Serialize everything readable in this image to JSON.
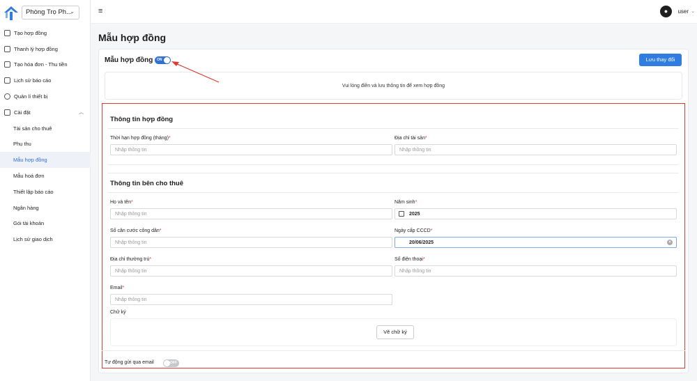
{
  "sidebar": {
    "property_select": "Phòng Trọ Ph...",
    "items": [
      {
        "label": "Tạo hợp đồng"
      },
      {
        "label": "Thanh lý hợp đồng"
      },
      {
        "label": "Tạo hóa đơn - Thu tiền"
      },
      {
        "label": "Lịch sử báo cáo"
      },
      {
        "label": "Quản lí thiết bị"
      },
      {
        "label": "Cài đặt"
      }
    ],
    "sub_items": [
      {
        "label": "Tài sản cho thuê"
      },
      {
        "label": "Phụ thu"
      },
      {
        "label": "Mẫu hợp đồng"
      },
      {
        "label": "Mẫu hoá đơn"
      },
      {
        "label": "Thiết lập báo cáo"
      },
      {
        "label": "Ngân hàng"
      },
      {
        "label": "Gói tài khoản"
      },
      {
        "label": "Lịch sử giao dịch"
      }
    ]
  },
  "topbar": {
    "username": "user"
  },
  "page": {
    "title": "Mẫu hợp đồng"
  },
  "card": {
    "title": "Mẫu hợp đồng",
    "toggle_on": "ON",
    "save_label": "Lưu thay đổi",
    "notice": "Vui lòng điền và lưu thông tin để xem hợp đồng"
  },
  "contract_section": {
    "title": "Thông tin hợp đồng",
    "term_label": "Thời hạn hợp đồng (tháng)",
    "address_label": "Địa chỉ tài sản",
    "placeholder": "Nhập thông tin"
  },
  "landlord_section": {
    "title": "Thông tin bên cho thuê",
    "name_label": "Họ và tên",
    "birth_year_label": "Năm sinh",
    "birth_year_value": "2025",
    "id_label": "Số căn cước công dân",
    "id_date_label": "Ngày cấp CCCD",
    "id_date_value": "20/06/2025",
    "residence_label": "Địa chỉ thường trú",
    "phone_label": "Số điện thoại",
    "email_label": "Email",
    "signature_label": "Chữ ký",
    "signature_button": "Vẽ chữ ký",
    "placeholder": "Nhập thông tin",
    "required_mark": "*"
  },
  "footer": {
    "auto_email_label": "Tự động gửi qua email",
    "toggle_off": "OFF"
  },
  "colors": {
    "primary": "#2f6fd6",
    "highlight": "#e03a2f"
  }
}
